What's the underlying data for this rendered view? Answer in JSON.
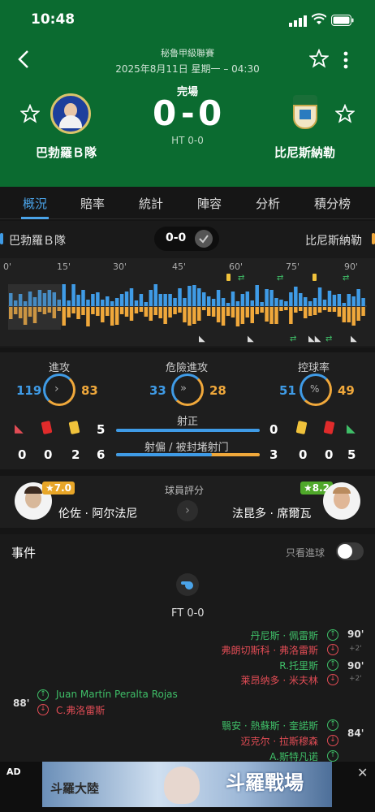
{
  "status_bar": {
    "time": "10:48"
  },
  "header": {
    "league": "秘魯甲級聯賽",
    "datetime": "2025年8月11日 星期一 – 04:30",
    "state": "完場",
    "score_home": "0",
    "score_dash": "-",
    "score_away": "0",
    "half_time": "HT 0-0",
    "home_team": "巴勃羅Ｂ隊",
    "away_team": "比尼斯納勒"
  },
  "tabs": [
    "概況",
    "賠率",
    "統計",
    "陣容",
    "分析",
    "積分榜"
  ],
  "momentum": {
    "home": "巴勃羅Ｂ隊",
    "score": "0-0",
    "away": "比尼斯納勒",
    "ticks": [
      "0'",
      "15'",
      "30'",
      "45'",
      "60'",
      "75'",
      "90'"
    ]
  },
  "stats": {
    "attack_label": "進攻",
    "attack_home": "119",
    "attack_away": "83",
    "danger_label": "危險進攻",
    "danger_home": "33",
    "danger_away": "28",
    "possession_label": "控球率",
    "possession_home": "51",
    "possession_away": "49",
    "home_corners": "0",
    "home_red": "0",
    "home_yellow": "2",
    "home_on_target": "5",
    "home_off_target": "6",
    "away_on_target": "0",
    "away_off_target": "3",
    "away_yellow": "0",
    "away_red": "0",
    "away_corners": "5",
    "on_target_label": "射正",
    "off_target_label": "射偏 / 被封堵射门"
  },
  "ratings": {
    "title": "球員評分",
    "home_rating": "★7.0",
    "home_player": "伦佐 · 阿尔法尼",
    "away_rating": "★8.2",
    "away_player": "法昆多 · 席爾瓦"
  },
  "events": {
    "title": "事件",
    "toggle_label": "只看進球",
    "ft": "FT 0-0",
    "list": [
      {
        "min": "90'",
        "in": "丹尼斯 · 佩雷斯",
        "out": "弗朗切斯科 · 弗洛雷斯",
        "extra": "+2'"
      },
      {
        "min": "90'",
        "in": "R.托里斯",
        "out": "莱昂纳多 · 米夫林",
        "extra": "+2'"
      },
      {
        "min": "88'",
        "in": "Juan Martín Peralta Rojas",
        "out": "C.弗洛雷斯",
        "extra": ""
      },
      {
        "min": "84'",
        "in": "翳安 · 熱蘇斯 · 奎諾斯",
        "out": "迈克尔 · 拉斯穆森",
        "extra": ""
      },
      {
        "min": "",
        "in": "A.斯特凡诺",
        "out": "",
        "extra": ""
      }
    ]
  },
  "ad": {
    "label": "AD",
    "text": "斗羅戰場",
    "subtext": "斗羅大陸"
  }
}
